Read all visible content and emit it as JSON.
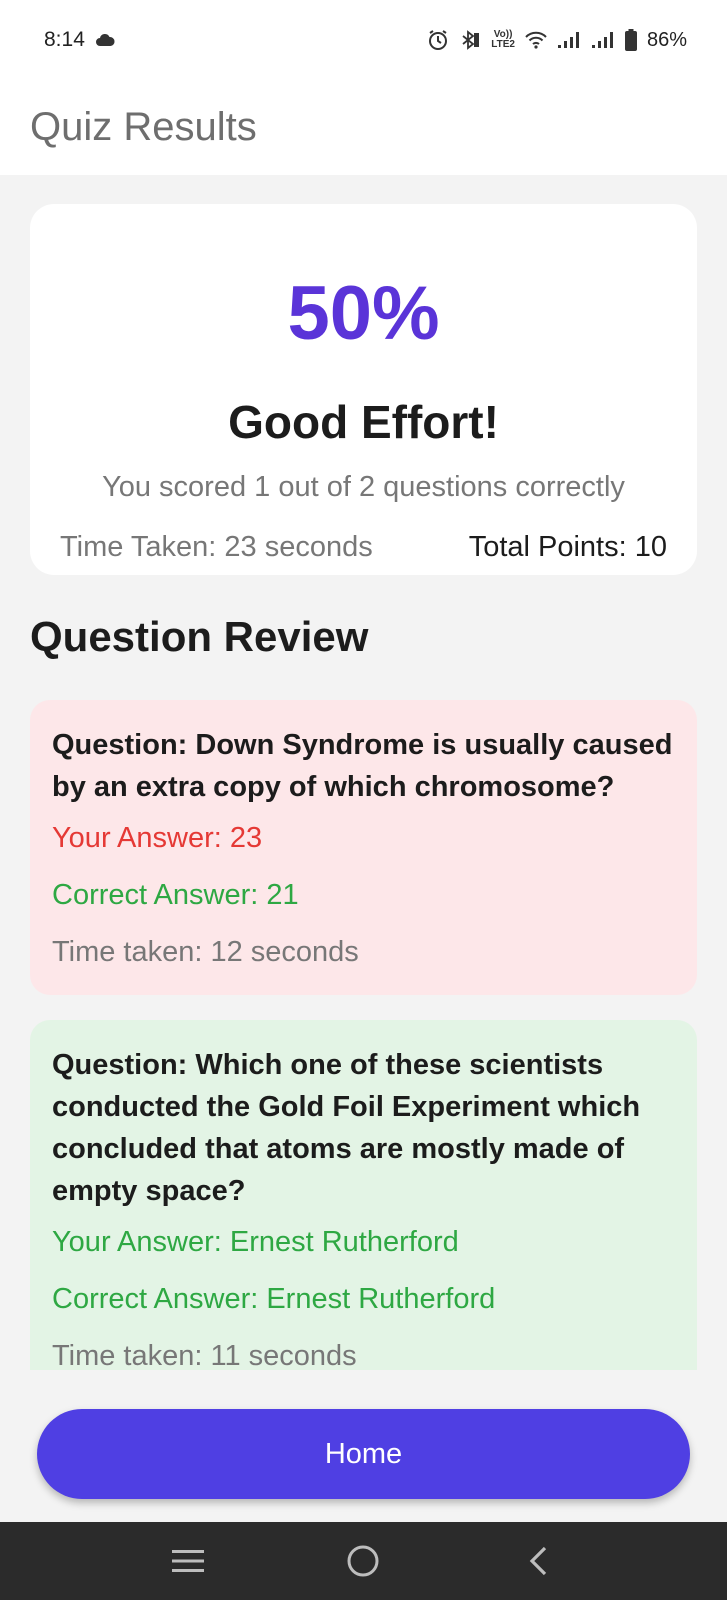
{
  "status_bar": {
    "time": "8:14",
    "battery": "86%",
    "volte_top": "Vo))",
    "volte_bottom": "LTE2"
  },
  "app_bar": {
    "title": "Quiz Results"
  },
  "score": {
    "percentage": "50%",
    "message": "Good Effort!",
    "summary": "You scored 1 out of 2 questions correctly",
    "time_taken": "Time Taken: 23 seconds",
    "total_points": "Total Points: 10"
  },
  "review": {
    "heading": "Question Review",
    "questions": [
      {
        "question": "Question: Down Syndrome is usually caused by an extra copy of which chromosome?",
        "your_answer": "Your Answer: 23",
        "correct_answer": "Correct Answer: 21",
        "time": "Time taken: 12 seconds",
        "status": "incorrect"
      },
      {
        "question": "Question: Which one of these scientists conducted the Gold Foil Experiment which concluded that atoms are mostly made of empty space?",
        "your_answer": "Your Answer: Ernest Rutherford",
        "correct_answer": "Correct Answer: Ernest Rutherford",
        "time": "Time taken: 11 seconds",
        "status": "correct"
      }
    ]
  },
  "footer": {
    "home_label": "Home"
  },
  "colors": {
    "accent": "#5a34d8",
    "button": "#4f3fe3",
    "wrong_bg": "#fde7e9",
    "right_bg": "#e3f4e5",
    "wrong_text": "#e53935",
    "right_text": "#2ea843"
  },
  "icons": [
    "cloud-icon",
    "alarm-icon",
    "bluetooth-icon",
    "wifi-icon",
    "signal-icon",
    "battery-icon",
    "menu-icon",
    "home-circle-icon",
    "back-icon"
  ]
}
